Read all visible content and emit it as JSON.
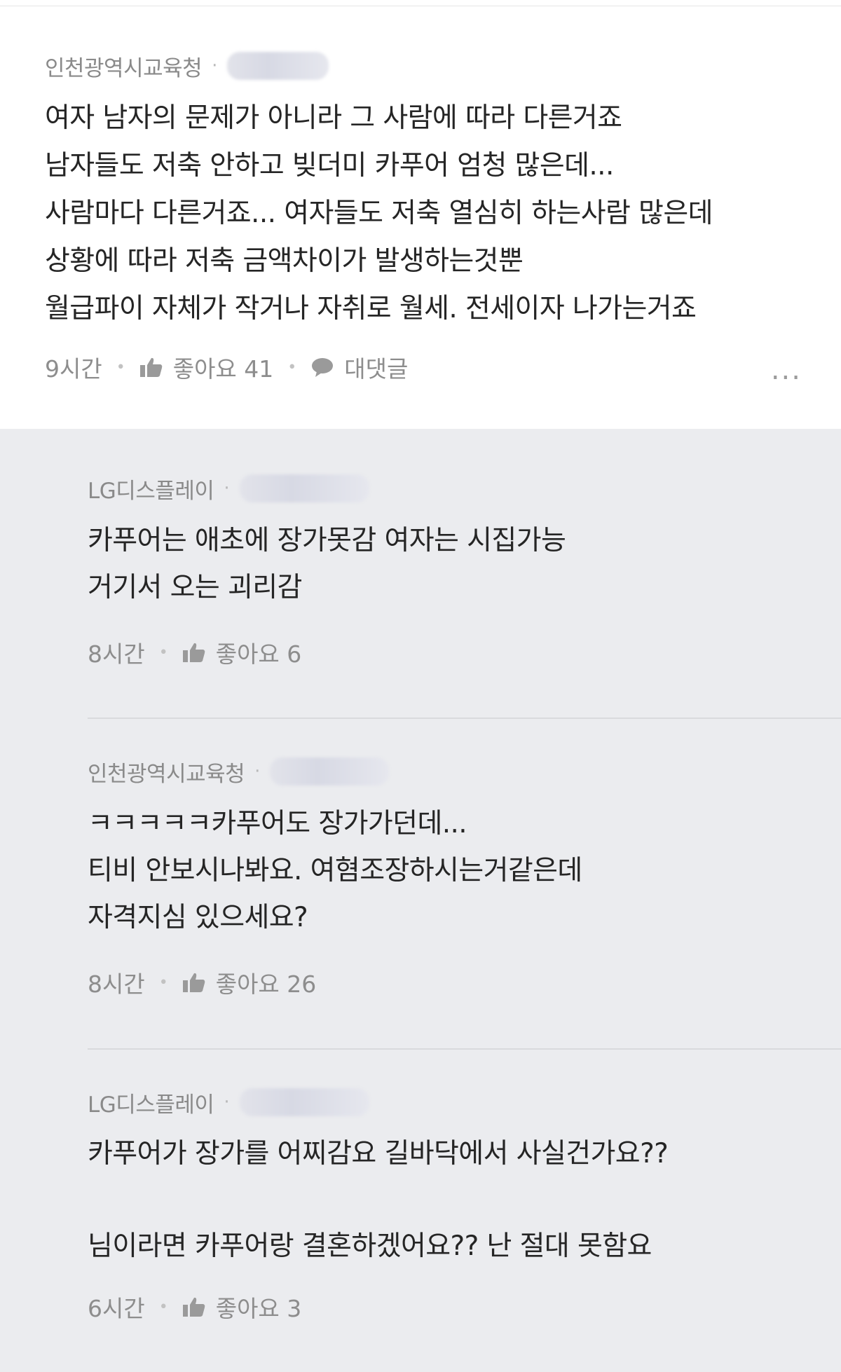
{
  "main": {
    "author": "인천광역시교육청",
    "lines": [
      "여자 남자의 문제가 아니라 그 사람에 따라 다른거죠",
      "남자들도 저축 안하고 빚더미 카푸어 엄청 많은데...",
      "사람마다 다른거죠... 여자들도 저축 열심히 하는사람 많은데",
      "상황에 따라 저축 금액차이가 발생하는것뿐",
      "월급파이 자체가 작거나 자취로 월세. 전세이자 나가는거죠"
    ],
    "time": "9시간",
    "like_label": "좋아요 41",
    "reply_label": "대댓글",
    "more_icon": "..."
  },
  "replies": [
    {
      "author": "LG디스플레이",
      "lines": [
        "카푸어는 애초에 장가못감 여자는 시집가능",
        "거기서 오는 괴리감"
      ],
      "time": "8시간",
      "like_label": "좋아요 6"
    },
    {
      "author": "인천광역시교육청",
      "lines": [
        "ㅋㅋㅋㅋㅋ카푸어도 장가가던데...",
        "티비 안보시나봐요. 여혐조장하시는거같은데",
        "자격지심 있으세요?"
      ],
      "time": "8시간",
      "like_label": "좋아요 26"
    },
    {
      "author": "LG디스플레이",
      "lines": [
        "카푸어가 장가를 어찌감요  길바닥에서 사실건가요??",
        "",
        "님이라면 카푸어랑 결혼하겠어요??  난 절대 못함요"
      ],
      "time": "6시간",
      "like_label": "좋아요 3"
    }
  ],
  "colors": {
    "background": "#ebecef",
    "card": "#ffffff",
    "meta": "#8d8d8d",
    "text": "#252525"
  },
  "icons": [
    "thumbs-up-icon",
    "speech-bubble-icon",
    "more-dots-icon"
  ]
}
